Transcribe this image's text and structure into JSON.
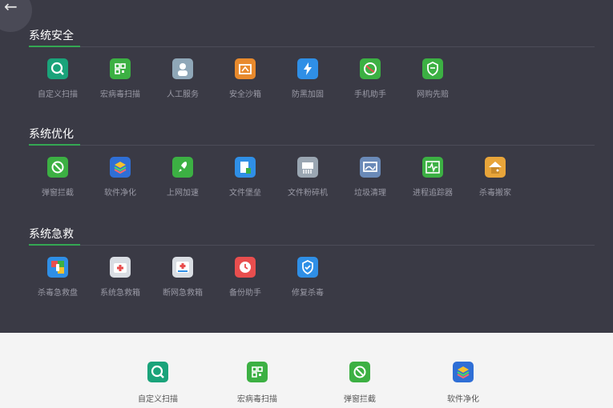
{
  "nav": {
    "back_icon": "arrow-left-icon",
    "back_glyph": "←"
  },
  "sections": [
    {
      "title": "系统安全",
      "items": [
        {
          "label": "自定义扫描",
          "icon": "magnifier-icon",
          "color": "#1aa37a"
        },
        {
          "label": "宏病毒扫描",
          "icon": "qr-scan-icon",
          "color": "#3cb043"
        },
        {
          "label": "人工服务",
          "icon": "doctor-icon",
          "color": "#8fa7b8"
        },
        {
          "label": "安全沙箱",
          "icon": "sandbox-icon",
          "color": "#e88a2d"
        },
        {
          "label": "防黑加固",
          "icon": "lightning-shield-icon",
          "color": "#2f8fe6"
        },
        {
          "label": "手机助手",
          "icon": "phone-ball-icon",
          "color": "#3cb043"
        },
        {
          "label": "网购先赔",
          "icon": "shield-shop-icon",
          "color": "#3cb043"
        }
      ]
    },
    {
      "title": "系统优化",
      "items": [
        {
          "label": "弹窗拦截",
          "icon": "block-popup-icon",
          "color": "#3cb043"
        },
        {
          "label": "软件净化",
          "icon": "layers-icon",
          "color": "#2f6fd6"
        },
        {
          "label": "上网加速",
          "icon": "rocket-icon",
          "color": "#3cb043"
        },
        {
          "label": "文件堡垒",
          "icon": "file-fortress-icon",
          "color": "#2f8fe6"
        },
        {
          "label": "文件粉碎机",
          "icon": "shredder-icon",
          "color": "#9aa6b2"
        },
        {
          "label": "垃圾清理",
          "icon": "screen-clean-icon",
          "color": "#6a8ab8"
        },
        {
          "label": "进程追踪器",
          "icon": "pulse-monitor-icon",
          "color": "#3cb043"
        },
        {
          "label": "杀毒搬家",
          "icon": "house-move-icon",
          "color": "#e8a53a"
        }
      ]
    },
    {
      "title": "系统急救",
      "items": [
        {
          "label": "杀毒急救盘",
          "icon": "usb-rescue-icon",
          "color": "#2f8fe6"
        },
        {
          "label": "系统急救箱",
          "icon": "first-aid-box-icon",
          "color": "#d9dde3"
        },
        {
          "label": "断网急救箱",
          "icon": "network-aid-box-icon",
          "color": "#d9dde3"
        },
        {
          "label": "备份助手",
          "icon": "backup-clock-icon",
          "color": "#e84e4e"
        },
        {
          "label": "修复杀毒",
          "icon": "repair-shield-icon",
          "color": "#2f8fe6"
        }
      ]
    }
  ],
  "bottom": {
    "items": [
      {
        "label": "自定义扫描",
        "icon": "magnifier-icon",
        "color": "#1aa37a"
      },
      {
        "label": "宏病毒扫描",
        "icon": "qr-scan-icon",
        "color": "#3cb043"
      },
      {
        "label": "弹窗拦截",
        "icon": "block-popup-icon",
        "color": "#3cb043"
      },
      {
        "label": "软件净化",
        "icon": "layers-icon",
        "color": "#2f6fd6"
      }
    ]
  }
}
